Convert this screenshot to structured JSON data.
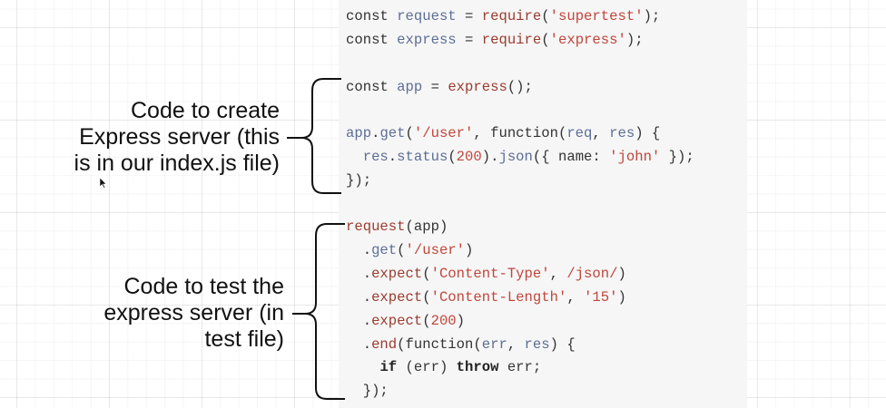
{
  "labels": {
    "top": {
      "line1": "Code to create",
      "line2": "Express server (this",
      "line3": "is in our index.js file)"
    },
    "bottom": {
      "line1": "Code to test the",
      "line2": "express server (in",
      "line3": "test file)"
    }
  },
  "code": {
    "l1": {
      "t1": "const ",
      "t2": "request",
      "t3": " = ",
      "t4": "require",
      "t5": "(",
      "t6": "'supertest'",
      "t7": ");"
    },
    "l2": {
      "t1": "const ",
      "t2": "express",
      "t3": " = ",
      "t4": "require",
      "t5": "(",
      "t6": "'express'",
      "t7": ");"
    },
    "l3": {
      "t1": "const ",
      "t2": "app",
      "t3": " = ",
      "t4": "express",
      "t5": "();"
    },
    "l4": {
      "t1": "app",
      "t2": ".",
      "t3": "get",
      "t4": "(",
      "t5": "'/user'",
      "t6": ", function(",
      "t7": "req",
      "t8": ", ",
      "t9": "res",
      "t10": ") {"
    },
    "l5": {
      "t1": "  ",
      "t2": "res",
      "t3": ".",
      "t4": "status",
      "t5": "(",
      "t6": "200",
      "t7": ").",
      "t8": "json",
      "t9": "({ name: ",
      "t10": "'john'",
      "t11": " });"
    },
    "l6": {
      "t1": "});"
    },
    "l7": {
      "t1": "request",
      "t2": "(app)"
    },
    "l8": {
      "t1": "  .",
      "t2": "get",
      "t3": "(",
      "t4": "'/user'",
      "t5": ")"
    },
    "l9": {
      "t1": "  .",
      "t2": "expect",
      "t3": "(",
      "t4": "'Content-Type'",
      "t5": ", ",
      "t6": "/json/",
      "t7": ")"
    },
    "l10": {
      "t1": "  .",
      "t2": "expect",
      "t3": "(",
      "t4": "'Content-Length'",
      "t5": ", ",
      "t6": "'15'",
      "t7": ")"
    },
    "l11": {
      "t1": "  .",
      "t2": "expect",
      "t3": "(",
      "t4": "200",
      "t5": ")"
    },
    "l12": {
      "t1": "  .",
      "t2": "end",
      "t3": "(function(",
      "t4": "err",
      "t5": ", ",
      "t6": "res",
      "t7": ") {"
    },
    "l13": {
      "t1": "    ",
      "t2": "if",
      "t3": " (err) ",
      "t4": "throw",
      "t5": " err;"
    },
    "l14": {
      "t1": "  });"
    }
  },
  "colors": {
    "keyword": "#333333",
    "identifier": "#5c6e96",
    "function": "#9b3b2e",
    "string": "#c0463b",
    "code_background": "#f6f6f6",
    "grid_line": "#e6e6e6"
  }
}
